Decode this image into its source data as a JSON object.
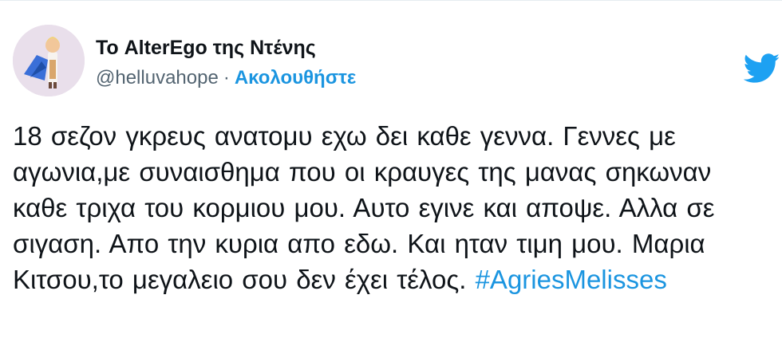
{
  "author": {
    "display_name": "Το AlterEgo της Ντένης",
    "handle": "@helluvahope",
    "separator": "·",
    "follow_label": "Ακολουθήστε"
  },
  "tweet": {
    "text": "18 σεζον γκρευς ανατομυ εχω δει καθε γεννα. Γεννες με αγωνια,με συναισθημα που οι κραυγες της μανας σηκωναν καθε τριχα του κορμιου μου. Αυτο εγινε και αποψε. Αλλα σε σιγαση. Απο την κυρια απο εδω. Και ηταν τιμη μου. Μαρια Κιτσου,το μεγαλειο σου δεν έχει τέλος.",
    "hashtag": "#AgriesMelisses"
  },
  "colors": {
    "link": "#1b95e0",
    "text": "#0f1419",
    "secondary": "#536471"
  },
  "icons": {
    "brand": "twitter-bird-icon",
    "avatar": "avatar-illustration"
  }
}
